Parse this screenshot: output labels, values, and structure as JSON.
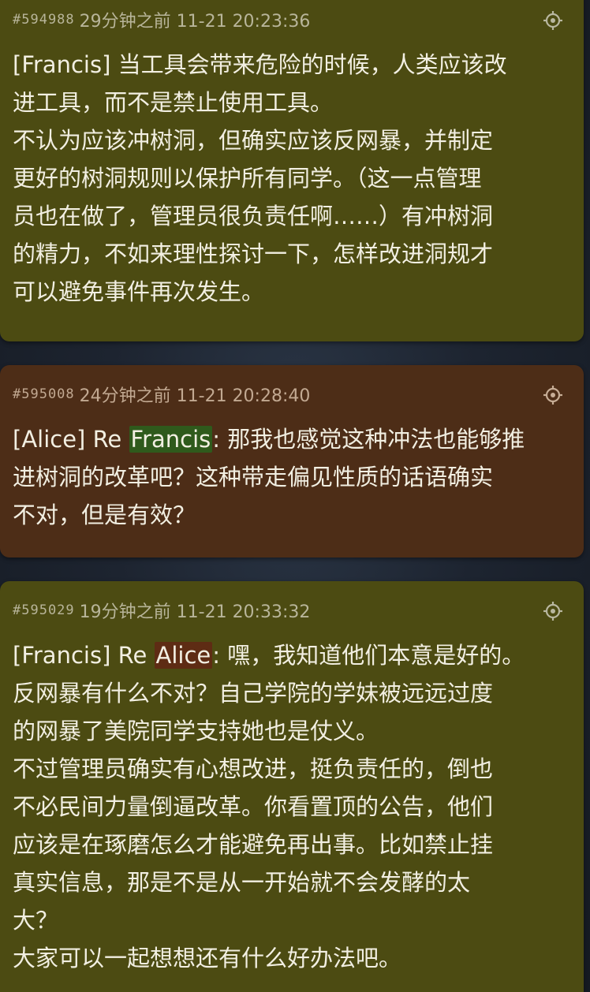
{
  "posts": [
    {
      "pid": "#594988",
      "time": "29分钟之前 11-21 20:23:36",
      "text": "[Francis] 当工具会带来危险的时候，人类应该改\n进工具，而不是禁止使用工具。\n不认为应该冲树洞，但确实应该反网暴，并制定\n更好的树洞规则以保护所有同学。（这一点管理\n员也在做了，管理员很负责任啊……）有冲树洞\n的精力，不如来理性探讨一下，怎样改进洞规才\n可以避免事件再次发生。",
      "bg": "#4c4b12"
    },
    {
      "pid": "#595008",
      "time": "24分钟之前 11-21 20:28:40",
      "prefix": "[Alice] Re ",
      "reply_to": "Francis",
      "text": ": 那我也感觉这种冲法也能够推\n进树洞的改革吧？这种带走偏见性质的话语确实\n不对，但是有效？",
      "bg": "#4d2d17"
    },
    {
      "pid": "#595029",
      "time": "19分钟之前 11-21 20:33:32",
      "prefix": "[Francis] Re ",
      "reply_to": "Alice",
      "text": ": 嘿，我知道他们本意是好的。\n反网暴有什么不对？自己学院的学妹被远远过度\n的网暴了美院同学支持她也是仗义。\n不过管理员确实有心想改进，挺负责任的，倒也\n不必民间力量倒逼改革。你看置顶的公告，他们\n应该是在琢磨怎么才能避免再出事。比如禁止挂\n真实信息，那是不是从一开始就不会发酵的太\n大？\n大家可以一起想想还有什么好办法吧。",
      "bg": "#4c4b12"
    }
  ],
  "icons": {
    "attention": "crosshair-icon"
  }
}
